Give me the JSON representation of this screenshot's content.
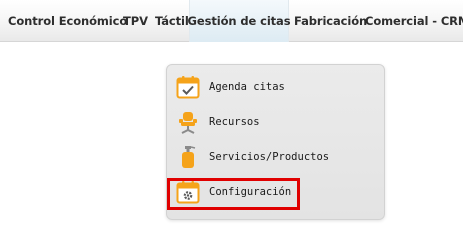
{
  "menubar": {
    "items": [
      {
        "label": "Control Económico"
      },
      {
        "label": "TPV"
      },
      {
        "label": "Táctil"
      },
      {
        "label": "Gestión de citas"
      },
      {
        "label": "Fabricación"
      },
      {
        "label": "Comercial - CRM"
      }
    ],
    "active_index": 3
  },
  "dropdown": {
    "items": [
      {
        "label": "Agenda citas",
        "icon": "calendar-check-icon"
      },
      {
        "label": "Recursos",
        "icon": "chair-icon"
      },
      {
        "label": "Servicios/Productos",
        "icon": "spray-bottle-icon"
      },
      {
        "label": "Configuración",
        "icon": "calendar-gear-icon"
      }
    ],
    "highlighted_index": 3
  },
  "colors": {
    "highlight": "#e00000",
    "icon_orange": "#f5a31a",
    "active_tab": "#ddebf3"
  }
}
